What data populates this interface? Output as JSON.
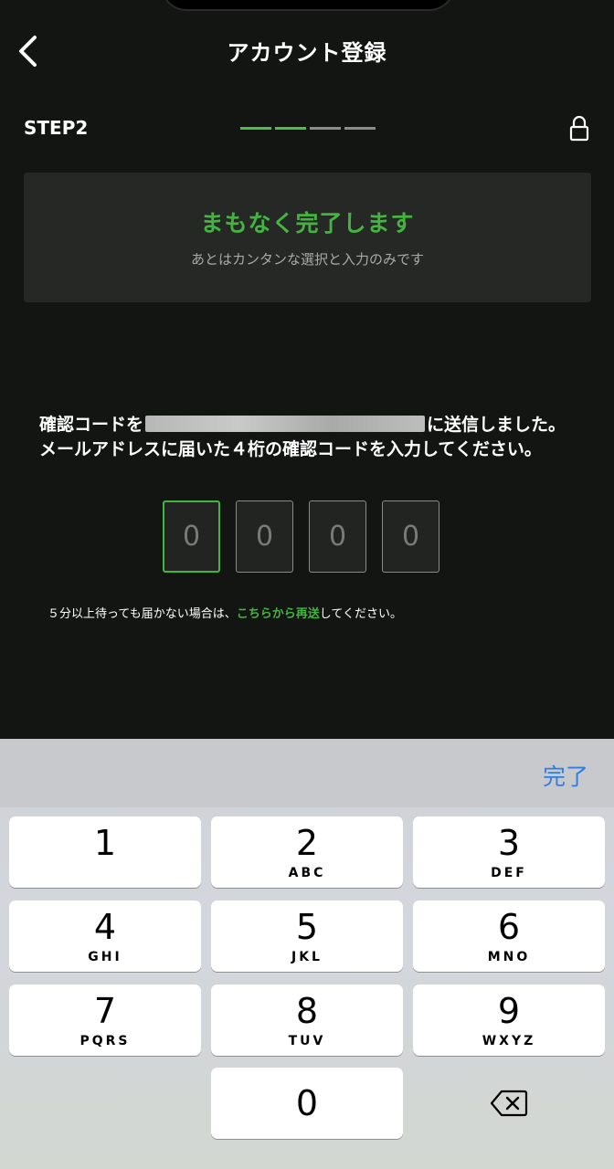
{
  "header": {
    "title": "アカウント登録"
  },
  "step": {
    "label": "STEP2"
  },
  "banner": {
    "title": "まもなく完了します",
    "subtitle": "あとはカンタンな選択と入力のみです"
  },
  "message": {
    "before": "確認コードを",
    "after": "に送信しました。メールアドレスに届いた４桁の確認コードを入力してください。"
  },
  "code": {
    "digits": [
      "0",
      "0",
      "0",
      "0"
    ]
  },
  "resend": {
    "before": "５分以上待っても届かない場合は、",
    "link": "こちらから再送",
    "after": "してください。"
  },
  "keyboard": {
    "done_label": "完了",
    "keys": [
      {
        "num": "1",
        "sub": ""
      },
      {
        "num": "2",
        "sub": "ABC"
      },
      {
        "num": "3",
        "sub": "DEF"
      },
      {
        "num": "4",
        "sub": "GHI"
      },
      {
        "num": "5",
        "sub": "JKL"
      },
      {
        "num": "6",
        "sub": "MNO"
      },
      {
        "num": "7",
        "sub": "PQRS"
      },
      {
        "num": "8",
        "sub": "TUV"
      },
      {
        "num": "9",
        "sub": "WXYZ"
      },
      {
        "num": "0",
        "sub": ""
      }
    ]
  },
  "colors": {
    "accent": "#43b53f",
    "background": "#131513",
    "keyboard_link": "#2f7fe0"
  },
  "progress": {
    "current_step": 2,
    "total_steps": 4
  }
}
